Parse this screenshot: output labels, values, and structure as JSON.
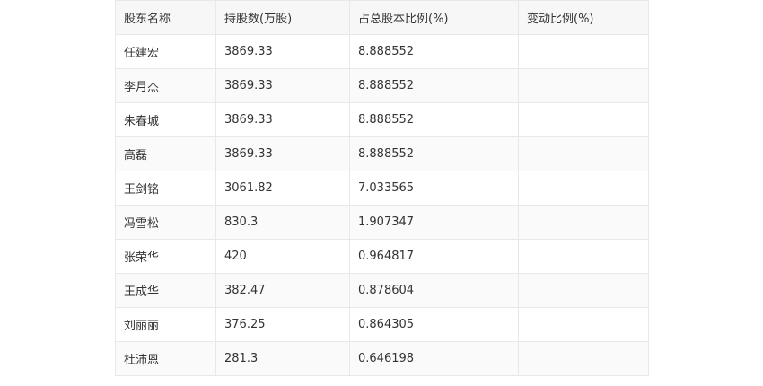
{
  "table": {
    "headers": [
      "股东名称",
      "持股数(万股)",
      "占总股本比例(%)",
      "变动比例(%)"
    ],
    "rows": [
      [
        "任建宏",
        "3869.33",
        "8.888552",
        ""
      ],
      [
        "李月杰",
        "3869.33",
        "8.888552",
        ""
      ],
      [
        "朱春城",
        "3869.33",
        "8.888552",
        ""
      ],
      [
        "高磊",
        "3869.33",
        "8.888552",
        ""
      ],
      [
        "王剑铭",
        "3061.82",
        "7.033565",
        ""
      ],
      [
        "冯雪松",
        "830.3",
        "1.907347",
        ""
      ],
      [
        "张荣华",
        "420",
        "0.964817",
        ""
      ],
      [
        "王成华",
        "382.47",
        "0.878604",
        ""
      ],
      [
        "刘丽丽",
        "376.25",
        "0.864305",
        ""
      ],
      [
        "杜沛恩",
        "281.3",
        "0.646198",
        ""
      ]
    ]
  }
}
